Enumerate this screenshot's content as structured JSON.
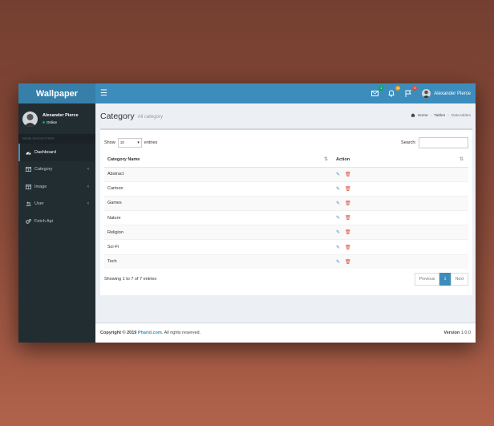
{
  "header": {
    "logo": "Wallpaper",
    "toggle_icon": "☰",
    "badges": {
      "messages": "4",
      "notifications": "10",
      "tasks": "9"
    },
    "user_name": "Alexander Pierce"
  },
  "sidebar": {
    "user_name": "Alexander Pierce",
    "status": "Online",
    "section_header": "MAIN NAVIGATION",
    "items": [
      {
        "label": "Dashboard",
        "icon": "dashboard-icon",
        "active": true,
        "has_chevron": false
      },
      {
        "label": "Category",
        "icon": "table-icon",
        "active": false,
        "has_chevron": true
      },
      {
        "label": "Image",
        "icon": "table-icon",
        "active": false,
        "has_chevron": true
      },
      {
        "label": "User",
        "icon": "users-icon",
        "active": false,
        "has_chevron": true
      },
      {
        "label": "Fetch Api",
        "icon": "cogs-icon",
        "active": false,
        "has_chevron": false
      }
    ],
    "chevron": "‹"
  },
  "content": {
    "title": "Category",
    "subtitle": "All category",
    "breadcrumb": {
      "home": "Home",
      "tables": "Tables",
      "current": "Data tables",
      "sep": "›"
    }
  },
  "table": {
    "show_label": "Show",
    "entries_value": "10",
    "entries_label": "entries",
    "search_label": "Search:",
    "search_value": "",
    "columns": [
      "Category Name",
      "Action"
    ],
    "rows": [
      "Abstract",
      "Cartoon",
      "Games",
      "Nature",
      "Religion",
      "Sci-Fi",
      "Tech"
    ],
    "info": "Showing 1 to 7 of 7 entries",
    "pager": {
      "prev": "Previous",
      "page": "1",
      "next": "Next"
    }
  },
  "footer": {
    "copyright_prefix": "Copyright © 2019",
    "link": "Pharid.com",
    "suffix": ". All rights reserved.",
    "version_label": "Version",
    "version": "1.0.0"
  },
  "colors": {
    "primary": "#3c8dbc",
    "logo_bg": "#367fa9",
    "sidebar": "#222d32",
    "danger": "#dd4b39"
  }
}
